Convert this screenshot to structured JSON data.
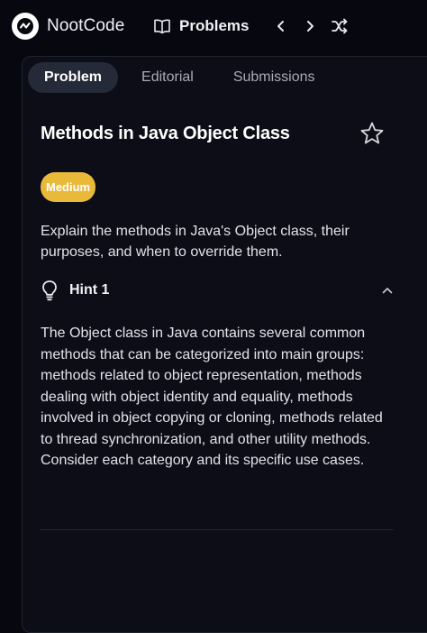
{
  "header": {
    "brand": "NootCode",
    "problems_label": "Problems",
    "icons": {
      "logo": "nootcode-logo-icon",
      "problems": "book-open-icon",
      "prev": "chevron-left-icon",
      "next": "chevron-right-icon",
      "random": "shuffle-icon"
    }
  },
  "tabs": [
    {
      "label": "Problem",
      "active": true
    },
    {
      "label": "Editorial",
      "active": false
    },
    {
      "label": "Submissions",
      "active": false
    }
  ],
  "problem": {
    "title": "Methods in Java Object Class",
    "difficulty": "Medium",
    "description": "Explain the methods in Java's Object class, their purposes, and when to override them."
  },
  "hint": {
    "label": "Hint 1",
    "expanded": true,
    "body": "The Object class in Java contains several common methods that can be categorized into main groups: methods related to object representation, methods dealing with object identity and equality, methods involved in object copying or cloning, methods related to thread synchronization, and other utility methods. Consider each category and its specific use cases."
  },
  "colors": {
    "background": "#07080f",
    "panel": "#0c0d16",
    "active_tab": "#252a38",
    "difficulty_medium": "#e9b93a"
  }
}
